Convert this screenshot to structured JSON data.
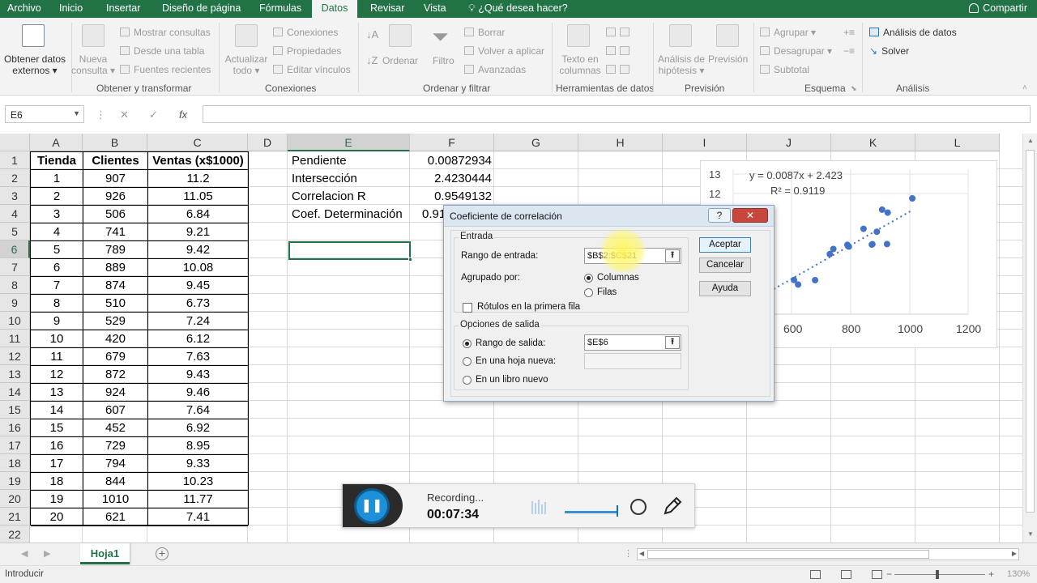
{
  "menu": {
    "tabs": [
      "Archivo",
      "Inicio",
      "Insertar",
      "Diseño de página",
      "Fórmulas",
      "Datos",
      "Revisar",
      "Vista",
      "¿Qué desea hacer?"
    ],
    "active_tab": "Datos",
    "share": "Compartir"
  },
  "ribbon": {
    "obtener_datos": [
      "Obtener datos",
      "externos ▾"
    ],
    "nueva_consulta": [
      "Nueva",
      "consulta ▾"
    ],
    "mostrar_consultas": "Mostrar consultas",
    "desde_tabla": "Desde una tabla",
    "fuentes_recientes": "Fuentes recientes",
    "grp_obtener": "Obtener y transformar",
    "actualizar": [
      "Actualizar",
      "todo ▾"
    ],
    "conexiones": "Conexiones",
    "propiedades": "Propiedades",
    "editar_vinculos": "Editar vínculos",
    "grp_conexiones": "Conexiones",
    "ordenar": "Ordenar",
    "filtro": "Filtro",
    "borrar": "Borrar",
    "volver_aplicar": "Volver a aplicar",
    "avanzadas": "Avanzadas",
    "grp_ordenar": "Ordenar y filtrar",
    "texto_columnas": [
      "Texto en",
      "columnas"
    ],
    "grp_herramientas": "Herramientas de datos",
    "analisis_hipotesis": [
      "Análisis de",
      "hipótesis ▾"
    ],
    "prevision": "Previsión",
    "grp_prevision": "Previsión",
    "agrupar": "Agrupar",
    "desagrupar": "Desagrupar",
    "subtotal": "Subtotal",
    "grp_esquema": "Esquema",
    "analisis_datos": "Análisis de datos",
    "solver": "Solver",
    "grp_analisis": "Análisis"
  },
  "formula_bar": {
    "name_box": "E6",
    "fx": "fx",
    "value": ""
  },
  "columns": [
    "A",
    "B",
    "C",
    "D",
    "E",
    "F",
    "G",
    "H",
    "I",
    "J",
    "K",
    "L"
  ],
  "selected_column": "E",
  "selected_row": 6,
  "rows": [
    "1",
    "2",
    "3",
    "4",
    "5",
    "6",
    "7",
    "8",
    "9",
    "10",
    "11",
    "12",
    "13",
    "14",
    "15",
    "16",
    "17",
    "18",
    "19",
    "20",
    "21",
    "22"
  ],
  "table": {
    "headers": [
      "Tienda",
      "Clientes",
      "Ventas (x$1000)"
    ],
    "rows": [
      [
        "1",
        "907",
        "11.2"
      ],
      [
        "2",
        "926",
        "11.05"
      ],
      [
        "3",
        "506",
        "6.84"
      ],
      [
        "4",
        "741",
        "9.21"
      ],
      [
        "5",
        "789",
        "9.42"
      ],
      [
        "6",
        "889",
        "10.08"
      ],
      [
        "7",
        "874",
        "9.45"
      ],
      [
        "8",
        "510",
        "6.73"
      ],
      [
        "9",
        "529",
        "7.24"
      ],
      [
        "10",
        "420",
        "6.12"
      ],
      [
        "11",
        "679",
        "7.63"
      ],
      [
        "12",
        "872",
        "9.43"
      ],
      [
        "13",
        "924",
        "9.46"
      ],
      [
        "14",
        "607",
        "7.64"
      ],
      [
        "15",
        "452",
        "6.92"
      ],
      [
        "16",
        "729",
        "8.95"
      ],
      [
        "17",
        "794",
        "9.33"
      ],
      [
        "18",
        "844",
        "10.23"
      ],
      [
        "19",
        "1010",
        "11.77"
      ],
      [
        "20",
        "621",
        "7.41"
      ]
    ]
  },
  "stats": [
    {
      "label": "Pendiente",
      "value": "0.00872934"
    },
    {
      "label": "Intersección",
      "value": "2.4230444"
    },
    {
      "label": "Correlacion R",
      "value": "0.9549132"
    },
    {
      "label": "Coef. Determinación",
      "value": "0.91"
    }
  ],
  "chart": {
    "equation": "y = 0.0087x + 2.423",
    "r2": "R² = 0.9119",
    "ytick_13": "13",
    "ytick_12": "12",
    "xticks": [
      "600",
      "800",
      "1000",
      "1200"
    ]
  },
  "dialog": {
    "title": "Coeficiente de correlación",
    "help": "?",
    "close": "✕",
    "entrada": "Entrada",
    "rango_entrada_label": "Rango de entrada:",
    "rango_entrada_value": "$B$2:$C$21",
    "agrupado_label": "Agrupado por:",
    "columnas": "Columnas",
    "filas": "Filas",
    "rotulos": "Rótulos en la primera fila",
    "opciones_salida": "Opciones de salida",
    "rango_salida_label": "Rango de salida:",
    "rango_salida_value": "$E$6",
    "hoja_nueva": "En una hoja nueva:",
    "libro_nuevo": "En un libro nuevo",
    "aceptar": "Aceptar",
    "cancelar": "Cancelar",
    "ayuda": "Ayuda"
  },
  "recorder": {
    "label": "Recording...",
    "time": "00:07:34"
  },
  "sheet_tab": "Hoja1",
  "status": {
    "mode": "Introducir",
    "zoom": "130%"
  }
}
